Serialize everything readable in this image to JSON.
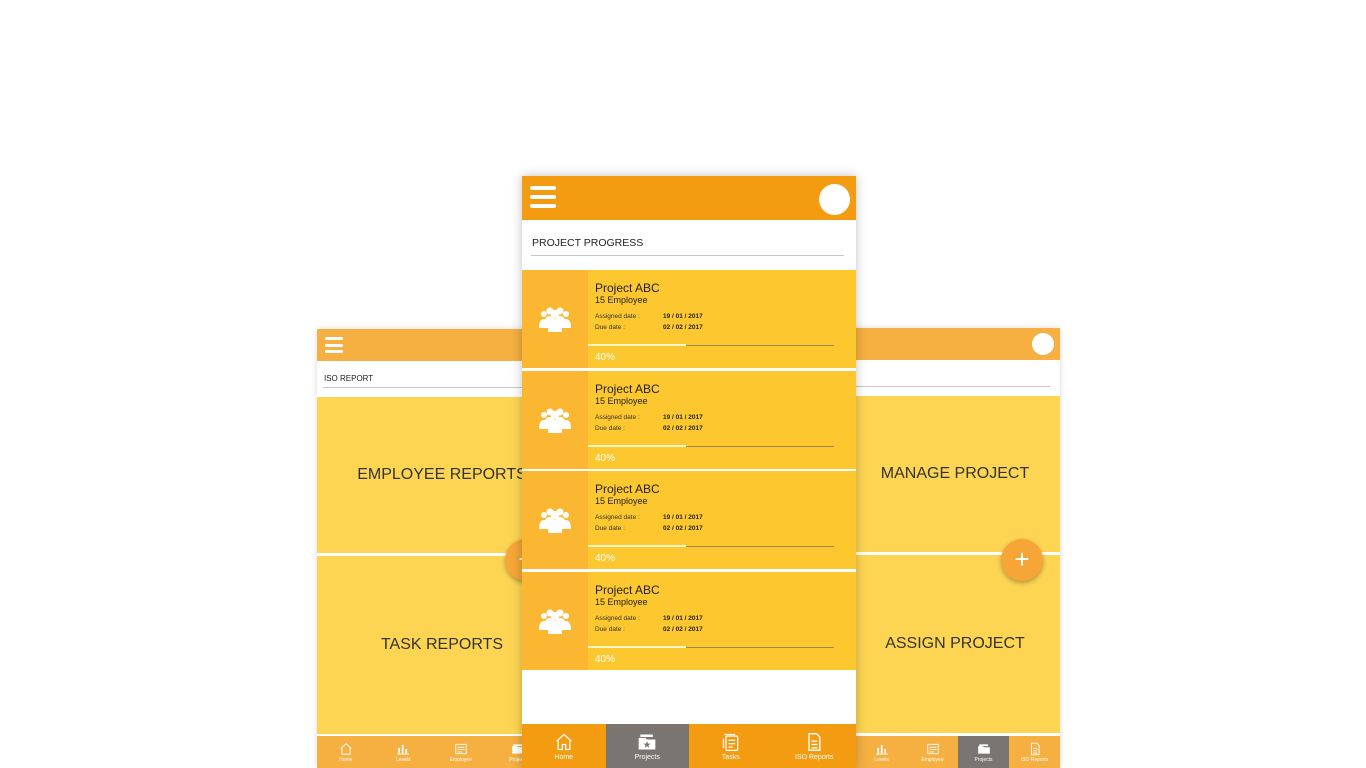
{
  "left_screen": {
    "title": "ISO REPORT",
    "tiles": [
      "EMPLOYEE REPORTS",
      "TASK REPORTS"
    ],
    "fab_label": "+",
    "nav": [
      {
        "label": "Home",
        "icon": "home-icon"
      },
      {
        "label": "Levels",
        "icon": "bar-chart-icon"
      },
      {
        "label": "Employee",
        "icon": "id-card-icon"
      },
      {
        "label": "Projects",
        "icon": "folder-icon"
      }
    ]
  },
  "center_screen": {
    "title": "PROJECT PROGRESS",
    "assigned_label": "Assigned date :",
    "due_label": "Due date :",
    "projects": [
      {
        "name": "Project ABC",
        "employees": "15 Employee",
        "assigned": "19 / 01 / 2017",
        "due": "02 / 02 / 2017",
        "progress_text": "40%",
        "progress": 0.4
      },
      {
        "name": "Project ABC",
        "employees": "15 Employee",
        "assigned": "19 / 01 / 2017",
        "due": "02 / 02 / 2017",
        "progress_text": "40%",
        "progress": 0.4
      },
      {
        "name": "Project ABC",
        "employees": "15 Employee",
        "assigned": "19 / 01 / 2017",
        "due": "02 / 02 / 2017",
        "progress_text": "40%",
        "progress": 0.4
      },
      {
        "name": "Project ABC",
        "employees": "15 Employee",
        "assigned": "19 / 01 / 2017",
        "due": "02 / 02 / 2017",
        "progress_text": "40%",
        "progress": 0.4
      }
    ],
    "nav": [
      {
        "label": "Home",
        "icon": "home-icon",
        "active": false
      },
      {
        "label": "Projects",
        "icon": "folder-icon",
        "active": true
      },
      {
        "label": "Tasks",
        "icon": "tasks-icon",
        "active": false
      },
      {
        "label": "ISO Reports",
        "icon": "document-icon",
        "active": false
      }
    ]
  },
  "right_screen": {
    "tiles": [
      "MANAGE PROJECT",
      "ASSIGN PROJECT"
    ],
    "fab_label": "+",
    "nav": [
      {
        "label": "Levels",
        "icon": "bar-chart-icon"
      },
      {
        "label": "Employee",
        "icon": "id-card-icon"
      },
      {
        "label": "Projects",
        "icon": "folder-icon"
      },
      {
        "label": "ISO Reports",
        "icon": "document-icon"
      }
    ]
  },
  "colors": {
    "appbar": "#f39c12",
    "appbar_light": "#f5b041",
    "card": "#fdc82f",
    "card_icon_bg": "#fbb731",
    "tile": "#fdd553",
    "nav_active": "#7a7571"
  }
}
